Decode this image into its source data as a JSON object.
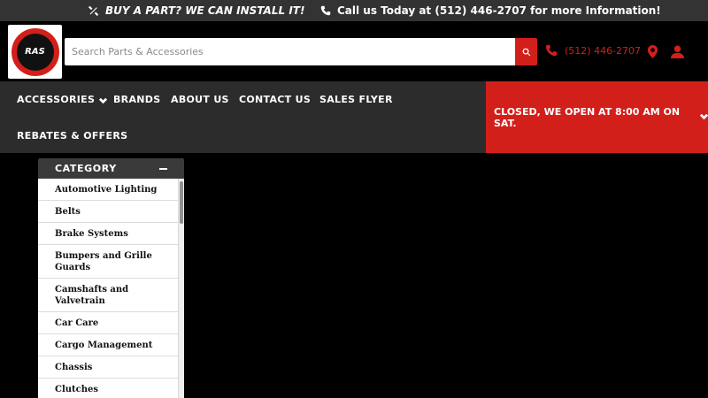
{
  "promo": {
    "install_text": "BUY A PART? WE CAN INSTALL IT!",
    "call_text": "Call us Today at (512) 446-2707 for more Information!"
  },
  "header": {
    "logo_text": "RAS",
    "search_placeholder": "Search Parts & Accessories",
    "phone": "(512) 446-2707"
  },
  "nav": {
    "accessories": "ACCESSORIES",
    "brands": "BRANDS",
    "about": "ABOUT US",
    "contact": "CONTACT US",
    "sales_flyer": "SALES FLYER",
    "rebates": "REBATES & OFFERS",
    "store_hours": "CLOSED, WE OPEN AT 8:00 AM ON SAT."
  },
  "category": {
    "title": "CATEGORY",
    "items": [
      "Automotive Lighting",
      "Belts",
      "Brake Systems",
      "Bumpers and Grille Guards",
      "Camshafts and Valvetrain",
      "Car Care",
      "Cargo Management",
      "Chassis",
      "Clutches"
    ]
  },
  "colors": {
    "accent": "#d31f1a",
    "nav_bg": "#2c2c2c",
    "promo_bg": "#333333"
  }
}
